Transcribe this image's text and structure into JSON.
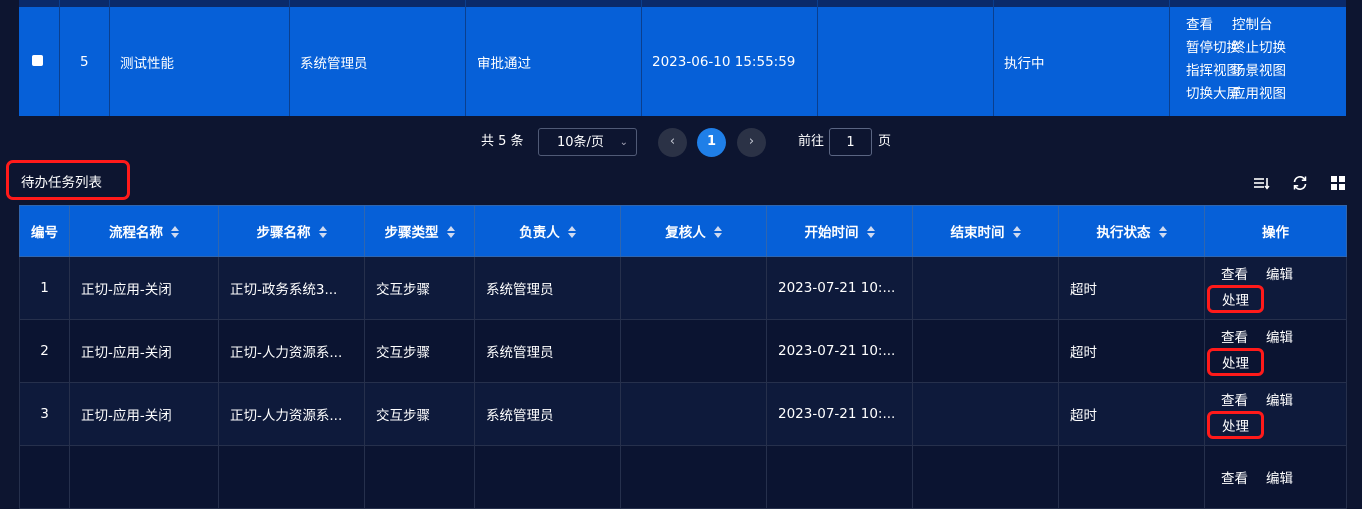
{
  "top_row": {
    "index": "5",
    "name": "测试性能",
    "creator": "系统管理员",
    "approval": "审批通过",
    "time": "2023-06-10 15:55:59",
    "empty": "",
    "status": "执行中",
    "ops": [
      "查看",
      "控制台",
      "暂停切换",
      "终止切换",
      "指挥视图",
      "场景视图",
      "切换大屏",
      "应用视图"
    ]
  },
  "pagination": {
    "total": "共 5 条",
    "page_size": "10条/页",
    "current": "1",
    "goto_label": "前往",
    "goto_value": "1",
    "unit": "页"
  },
  "section": {
    "title": "待办任务列表",
    "icons": [
      "column-filter-icon",
      "refresh-icon",
      "grid-view-icon"
    ]
  },
  "task_table": {
    "headers": [
      "编号",
      "流程名称",
      "步骤名称",
      "步骤类型",
      "负责人",
      "复核人",
      "开始时间",
      "结束时间",
      "执行状态",
      "操作"
    ],
    "rows": [
      {
        "id": "1",
        "flow": "正切-应用-关闭",
        "step": "正切-政务系统3...",
        "type": "交互步骤",
        "owner": "系统管理员",
        "reviewer": "",
        "start": "2023-07-21 10:...",
        "end": "",
        "status": "超时",
        "op_view": "查看",
        "op_edit": "编辑",
        "op_handle": "处理"
      },
      {
        "id": "2",
        "flow": "正切-应用-关闭",
        "step": "正切-人力资源系...",
        "type": "交互步骤",
        "owner": "系统管理员",
        "reviewer": "",
        "start": "2023-07-21 10:...",
        "end": "",
        "status": "超时",
        "op_view": "查看",
        "op_edit": "编辑",
        "op_handle": "处理"
      },
      {
        "id": "3",
        "flow": "正切-应用-关闭",
        "step": "正切-人力资源系...",
        "type": "交互步骤",
        "owner": "系统管理员",
        "reviewer": "",
        "start": "2023-07-21 10:...",
        "end": "",
        "status": "超时",
        "op_view": "查看",
        "op_edit": "编辑",
        "op_handle": "处理"
      },
      {
        "id": "",
        "flow": "",
        "step": "",
        "type": "",
        "owner": "",
        "reviewer": "",
        "start": "",
        "end": "",
        "status": "",
        "op_view": "查看",
        "op_edit": "编辑",
        "op_handle": ""
      }
    ]
  }
}
